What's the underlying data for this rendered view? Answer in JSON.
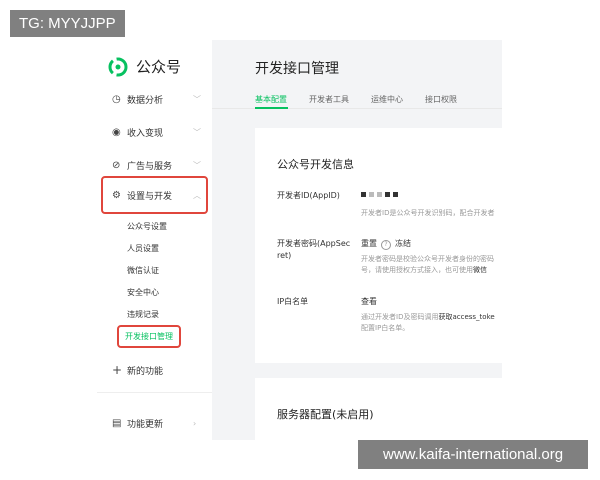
{
  "watermark_top": "TG: MYYJJPP",
  "watermark_bottom": "www.kaifa-international.org",
  "app": {
    "name": "公众号"
  },
  "sidebar": {
    "items": [
      {
        "label": "数据分析",
        "icon": "chart-icon"
      },
      {
        "label": "收入变现",
        "icon": "coin-icon"
      },
      {
        "label": "广告与服务",
        "icon": "compass-icon"
      },
      {
        "label": "设置与开发",
        "icon": "gear-icon"
      }
    ],
    "sub_items": [
      "公众号设置",
      "人员设置",
      "微信认证",
      "安全中心",
      "违规记录",
      "开发接口管理"
    ],
    "new_feature": "新的功能",
    "update": "功能更新"
  },
  "main": {
    "title": "开发接口管理",
    "tabs": [
      "基本配置",
      "开发者工具",
      "运维中心",
      "接口权限"
    ],
    "card1": {
      "title": "公众号开发信息",
      "appid_label": "开发者ID(AppID)",
      "appid_hint": "开发者ID是公众号开发识别码，配合开发者",
      "secret_label_1": "开发者密码(AppSec",
      "secret_label_2": "ret)",
      "reset": "重置",
      "help": "?",
      "freeze": "冻结",
      "secret_hint_1": "开发者密码是校验公众号开发者身份的密码",
      "secret_hint_2": "号，请使用授权方式接入，也可使用",
      "secret_hint_2b": "微信",
      "ip_label": "IP白名单",
      "ip_view": "查看",
      "ip_hint_1a": "通过开发者ID及密码调用",
      "ip_hint_1b": "获取access_toke",
      "ip_hint_2": "配置IP白名单。"
    },
    "card2": {
      "title": "服务器配置(未启用)"
    }
  },
  "colors": {
    "accent": "#07c160",
    "highlight": "#e0463c"
  }
}
